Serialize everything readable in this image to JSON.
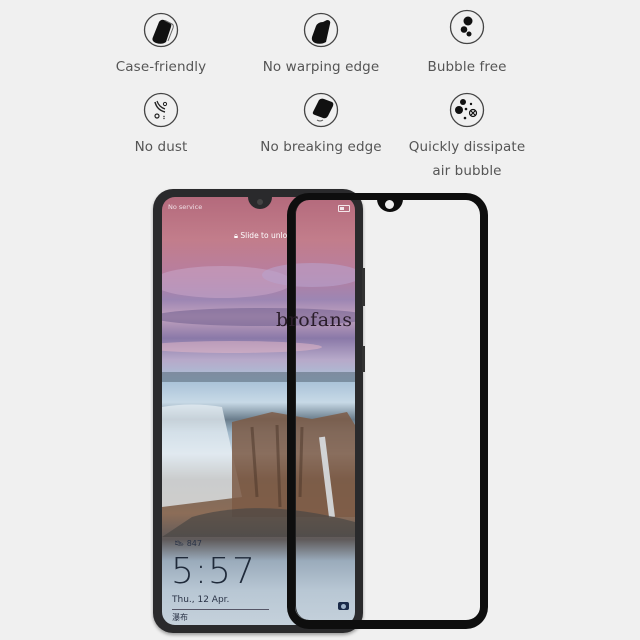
{
  "features": [
    {
      "label": "Case-friendly",
      "icon": "case-friendly-icon"
    },
    {
      "label": "No warping edge",
      "icon": "no-warping-edge-icon"
    },
    {
      "label": "Bubble free",
      "icon": "bubble-free-icon"
    },
    {
      "label": "No dust",
      "icon": "no-dust-icon"
    },
    {
      "label": "No breaking edge",
      "icon": "no-breaking-edge-icon"
    },
    {
      "label_line1": "Quickly dissipate",
      "label_line2": "air bubble",
      "icon": "dissipate-bubble-icon"
    }
  ],
  "phone_screen": {
    "status_left": "No service",
    "slide_to_unlock": "Slide to unlock",
    "steps": "847",
    "time": "5:57",
    "date": "Thu., 12 Apr.",
    "location": "瀑布"
  },
  "watermark": "brofans",
  "colors": {
    "background": "#f0f0f0",
    "phone_frame": "#2a2a2c",
    "glass_border": "#0e0e0e",
    "label_text": "#555555"
  }
}
